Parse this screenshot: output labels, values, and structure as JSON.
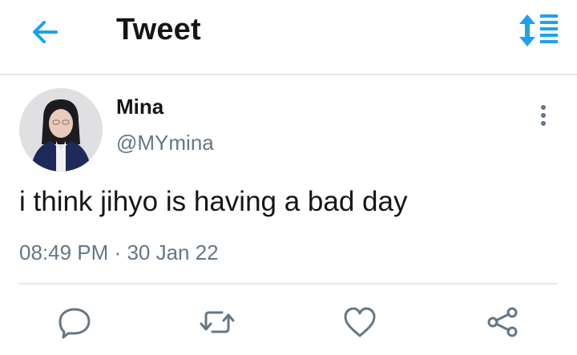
{
  "header": {
    "title": "Tweet",
    "back_icon": "arrow-left-icon",
    "sort_icon": "sort-order-icon",
    "accent": "#1da1f2"
  },
  "tweet": {
    "author_name": "Mina",
    "handle": "@MYmina",
    "text": "i think jihyo is having a bad day",
    "time": "08:49 PM",
    "separator": "·",
    "date": "30 Jan 22"
  },
  "actions": [
    {
      "icon": "reply-icon"
    },
    {
      "icon": "retweet-icon"
    },
    {
      "icon": "like-icon"
    },
    {
      "icon": "share-icon"
    }
  ],
  "colors": {
    "text": "#14171a",
    "muted": "#657786",
    "icon": "#657786",
    "divider": "#e1e8ed"
  }
}
